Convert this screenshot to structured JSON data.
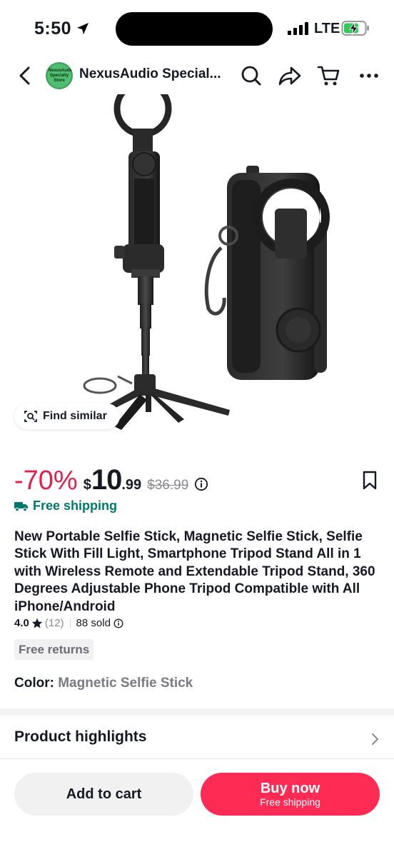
{
  "status_bar": {
    "time": "5:50",
    "network": "LTE",
    "icons": [
      "location-arrow-icon",
      "signal-icon",
      "battery-charging-icon"
    ]
  },
  "header": {
    "store_name": "NexusAudio Special...",
    "store_logo_text": "NexusAudio Specialty Store",
    "icons": [
      "back-icon",
      "search-icon",
      "share-icon",
      "cart-icon",
      "more-icon"
    ]
  },
  "gallery": {
    "find_similar_label": "Find similar",
    "image_count": 6,
    "active_index": 0
  },
  "price": {
    "discount": "-70%",
    "currency": "$",
    "integer": "10",
    "decimal": ".99",
    "original": "$36.99"
  },
  "shipping_label": "Free shipping",
  "product_title": "New Portable Selfie Stick, Magnetic Selfie Stick, Selfie Stick With Fill Light, Smartphone Tripod Stand All in 1 with Wireless Remote and Extendable Tripod Stand, 360 Degrees Adjustable Phone Tripod Compatible with All iPhone/Android",
  "rating": {
    "value": "4.0",
    "count": "(12)",
    "sold": "88 sold"
  },
  "returns_badge": "Free returns",
  "color": {
    "label": "Color:",
    "value": "Magnetic Selfie Stick"
  },
  "highlights_label": "Product highlights",
  "actions": {
    "add_to_cart": "Add to cart",
    "buy_now": "Buy now",
    "buy_now_sub": "Free shipping"
  },
  "colors": {
    "accent": "#fe2c55",
    "discount": "#e1214b",
    "shipping": "#00796b"
  }
}
